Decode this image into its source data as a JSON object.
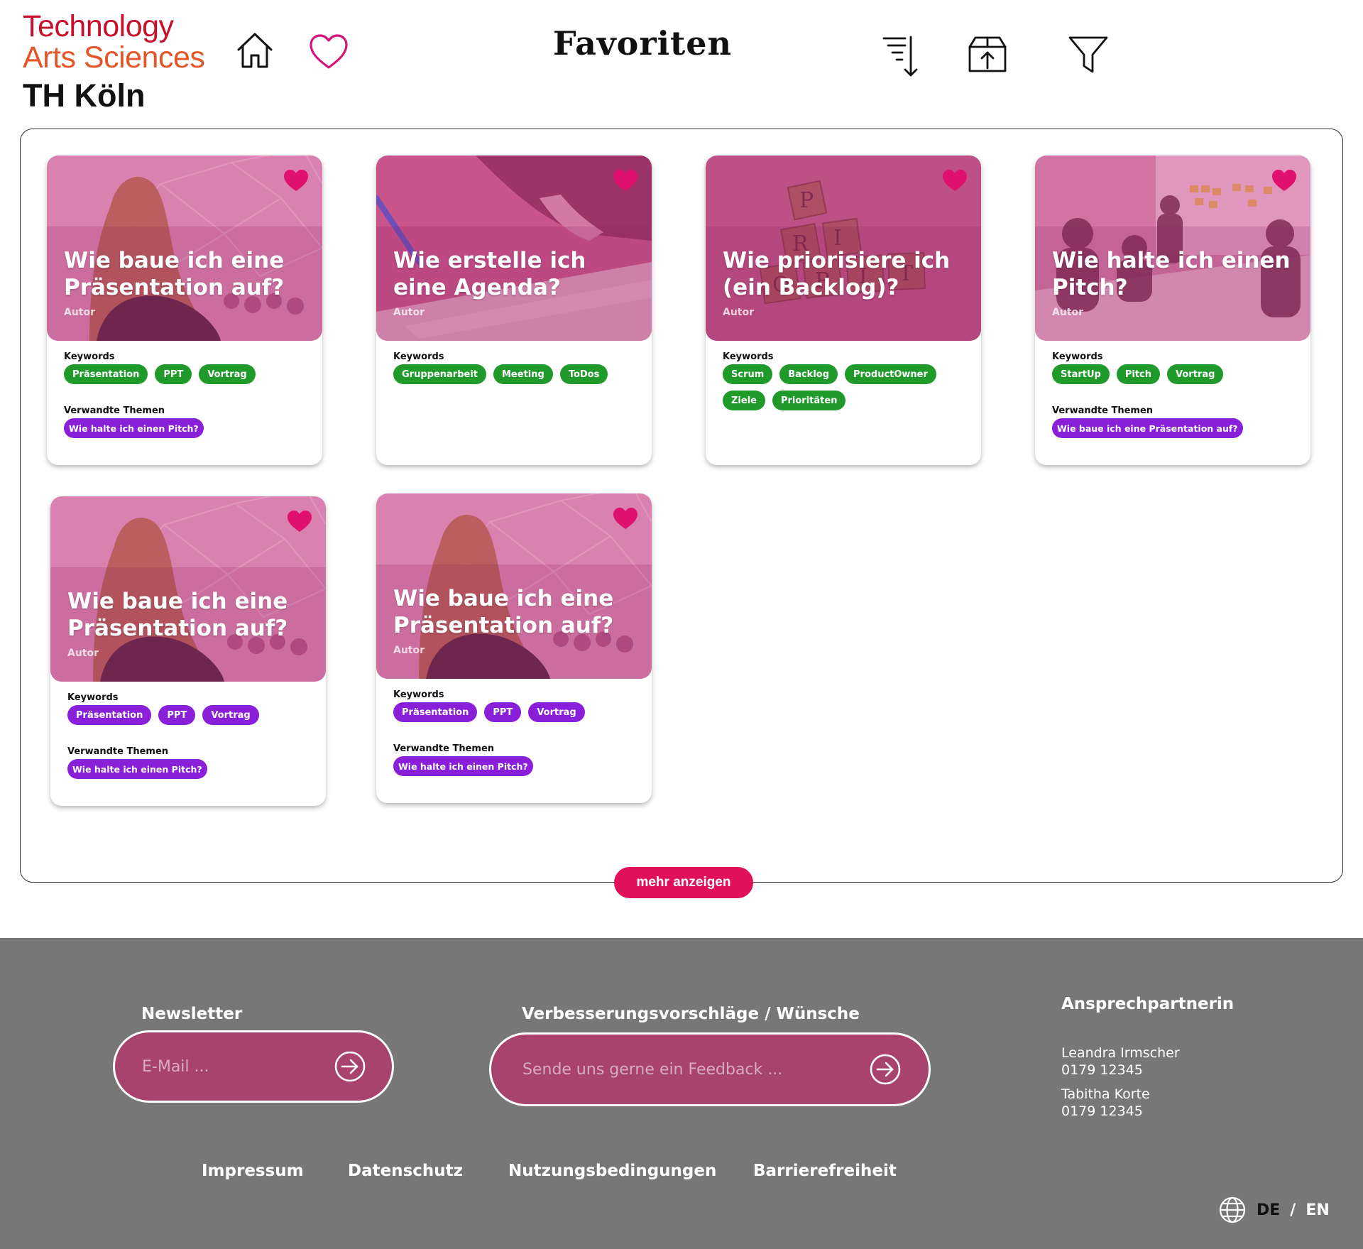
{
  "header": {
    "logo_line1": "Technology",
    "logo_line2": "Arts Sciences",
    "logo_line3": "TH Köln",
    "title": "Favoriten",
    "icons": [
      "home-icon",
      "heart-outline-icon",
      "sort-icon",
      "archive-upload-icon",
      "filter-icon"
    ]
  },
  "labels": {
    "keywords": "Keywords",
    "related": "Verwandte Themen",
    "author": "Autor"
  },
  "cards": [
    {
      "title": "Wie baue ich eine Präsentation auf?",
      "image": "presentation-speaker",
      "keywords": [
        "Präsentation",
        "PPT",
        "Vortrag"
      ],
      "keyword_color": "green",
      "related": [
        "Wie halte ich einen Pitch?"
      ]
    },
    {
      "title": "Wie erstelle ich eine Agenda?",
      "image": "writing-notes",
      "keywords": [
        "Gruppenarbeit",
        "Meeting",
        "ToDos"
      ],
      "keyword_color": "green",
      "related": []
    },
    {
      "title": "Wie priorisiere ich (ein Backlog)?",
      "image": "scrabble-tiles",
      "keywords": [
        "Scrum",
        "Backlog",
        "ProductOwner",
        "Ziele",
        "Prioritäten"
      ],
      "keyword_color": "green",
      "related": []
    },
    {
      "title": "Wie halte ich einen Pitch?",
      "image": "meeting-room",
      "keywords": [
        "StartUp",
        "Pitch",
        "Vortrag"
      ],
      "keyword_color": "green",
      "related": [
        "Wie baue ich eine Präsentation auf?"
      ]
    },
    {
      "title": "Wie baue ich eine Präsentation auf?",
      "image": "presentation-speaker",
      "keywords": [
        "Präsentation",
        "PPT",
        "Vortrag"
      ],
      "keyword_color": "purple",
      "related": [
        "Wie halte ich einen Pitch?"
      ]
    },
    {
      "title": "Wie baue ich eine Präsentation auf?",
      "image": "presentation-speaker",
      "keywords": [
        "Präsentation",
        "PPT",
        "Vortrag"
      ],
      "keyword_color": "purple",
      "related": [
        "Wie halte ich einen Pitch?"
      ]
    }
  ],
  "more_button": "mehr anzeigen",
  "footer": {
    "newsletter_label": "Newsletter",
    "newsletter_placeholder": "E-Mail ...",
    "feedback_label": "Verbesserungsvorschläge / Wünsche",
    "feedback_placeholder": "Sende uns gerne ein Feedback ...",
    "contact_title": "Ansprechpartnerin",
    "contacts": [
      {
        "name": "Leandra Irmscher",
        "phone": "0179 12345"
      },
      {
        "name": "Tabitha Korte",
        "phone": "0179 12345"
      }
    ],
    "links": [
      "Impressum",
      "Datenschutz",
      "Nutzungsbedingungen",
      "Barrierefreiheit"
    ],
    "lang_de": "DE",
    "lang_sep": "/",
    "lang_en": "EN"
  },
  "colors": {
    "accent": "#e0105a",
    "chip_green": "#1f9a2b",
    "chip_purple": "#8a1fd9",
    "footer_bg": "#777777",
    "pill_bg": "#a8436e"
  }
}
